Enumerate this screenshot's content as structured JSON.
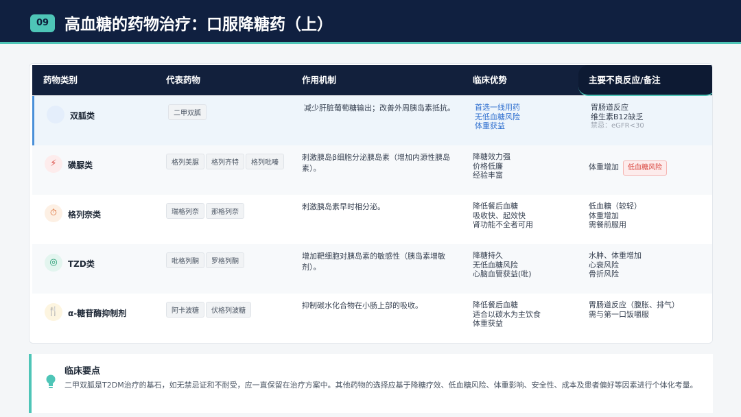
{
  "header": {
    "badge": "09",
    "title": "高血糖的药物治疗：口服降糖药（上）"
  },
  "colors": {
    "navy": "#102040",
    "teal": "#4ec5b7",
    "blue_text": "#2f6fcf",
    "risk_red": "#d9463f"
  },
  "table": {
    "columns": [
      "药物类别",
      "代表药物",
      "作用机制",
      "临床优势",
      "主要不良反应/备注"
    ],
    "rows": [
      {
        "icon": "metformin-circle-icon",
        "name": "双胍类",
        "drugs": [
          "二甲双胍"
        ],
        "mechanism": "减少肝脏葡萄糖输出；改善外周胰岛素抵抗。",
        "advantages": [
          "首选一线用药",
          "无低血糖风险",
          "体重获益"
        ],
        "notes": [
          "胃肠道反应",
          "维生素B12缺乏"
        ],
        "note_muted": "禁忌：eGFR<30"
      },
      {
        "icon": "lightning-icon",
        "name": "磺脲类",
        "drugs": [
          "格列美脲",
          "格列齐特",
          "格列吡嗪"
        ],
        "mechanism": "刺激胰岛β细胞分泌胰岛素（增加内源性胰岛素）。",
        "advantages": [
          "降糖效力强",
          "价格低廉",
          "经验丰富"
        ],
        "notes": [
          "体重增加"
        ],
        "risk_tag": "低血糖风险"
      },
      {
        "icon": "stopwatch-icon",
        "name": "格列奈类",
        "drugs": [
          "瑞格列奈",
          "那格列奈"
        ],
        "mechanism": "刺激胰岛素早时相分泌。",
        "advantages": [
          "降低餐后血糖",
          "吸收快、起效快",
          "肾功能不全者可用"
        ],
        "notes": [
          "低血糖（较轻）",
          "体重增加",
          "需餐前服用"
        ]
      },
      {
        "icon": "target-icon",
        "name": "TZD类",
        "drugs": [
          "吡格列酮",
          "罗格列酮"
        ],
        "mechanism": "增加靶细胞对胰岛素的敏感性（胰岛素增敏剂）。",
        "advantages": [
          "降糖持久",
          "无低血糖风险",
          "心脑血管获益(吡)"
        ],
        "notes": [
          "水肿、体重增加",
          "心衰风险",
          "骨折风险"
        ]
      },
      {
        "icon": "fork-knife-icon",
        "name": "α-糖苷酶抑制剂",
        "drugs": [
          "阿卡波糖",
          "伏格列波糖"
        ],
        "mechanism": "抑制碳水化合物在小肠上部的吸收。",
        "advantages": [
          "降低餐后血糖",
          "适合以碳水为主饮食",
          "体重获益"
        ],
        "notes": [
          "胃肠道反应（腹胀、排气）",
          "需与第一口饭嚼服"
        ]
      }
    ]
  },
  "clinical_note": {
    "icon": "lightbulb-icon",
    "title": "临床要点",
    "text": "二甲双胍是T2DM治疗的基石，如无禁忌证和不耐受，应一直保留在治疗方案中。其他药物的选择应基于降糖疗效、低血糖风险、体重影响、安全性、成本及患者偏好等因素进行个体化考量。"
  }
}
